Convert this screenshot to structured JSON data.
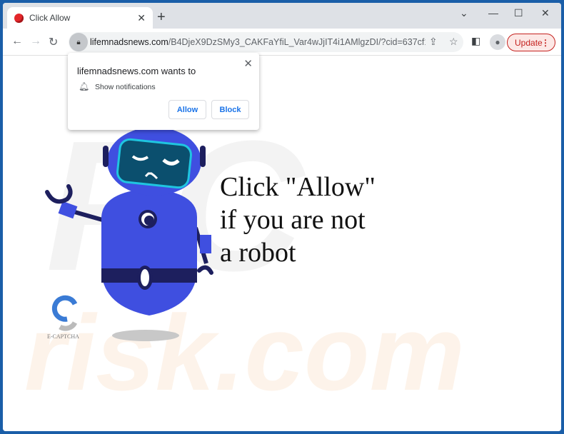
{
  "tab": {
    "title": "Click Allow",
    "close": "✕",
    "new_tab": "+"
  },
  "window_controls": {
    "dropdown": "⌄",
    "minimize": "—",
    "maximize": "☐",
    "close": "✕"
  },
  "toolbar": {
    "back": "←",
    "forward": "→",
    "reload": "↻",
    "url_domain": "lifemnadsnews.com",
    "url_path": "/B4DjeX9DzSMy3_CAKFaYfiL_Var4wJjIT4i1AMlgzDI/?cid=637cf154303...",
    "update_label": "Update"
  },
  "popup": {
    "title": "lifemnadsnews.com wants to",
    "permission": "Show notifications",
    "allow_label": "Allow",
    "block_label": "Block"
  },
  "page": {
    "headline": [
      "Click \"Allow\"",
      "if you are not",
      "a robot"
    ],
    "captcha_logo_text": "E-CAPTCHA",
    "watermark": "PC risk.com"
  },
  "colors": {
    "frame": "#1a5ea8",
    "robot": "#3f4fe0",
    "robot_dark": "#1d1f5e",
    "visor": "#1fc5e0",
    "update": "#c5221f",
    "link": "#1a73e8"
  }
}
